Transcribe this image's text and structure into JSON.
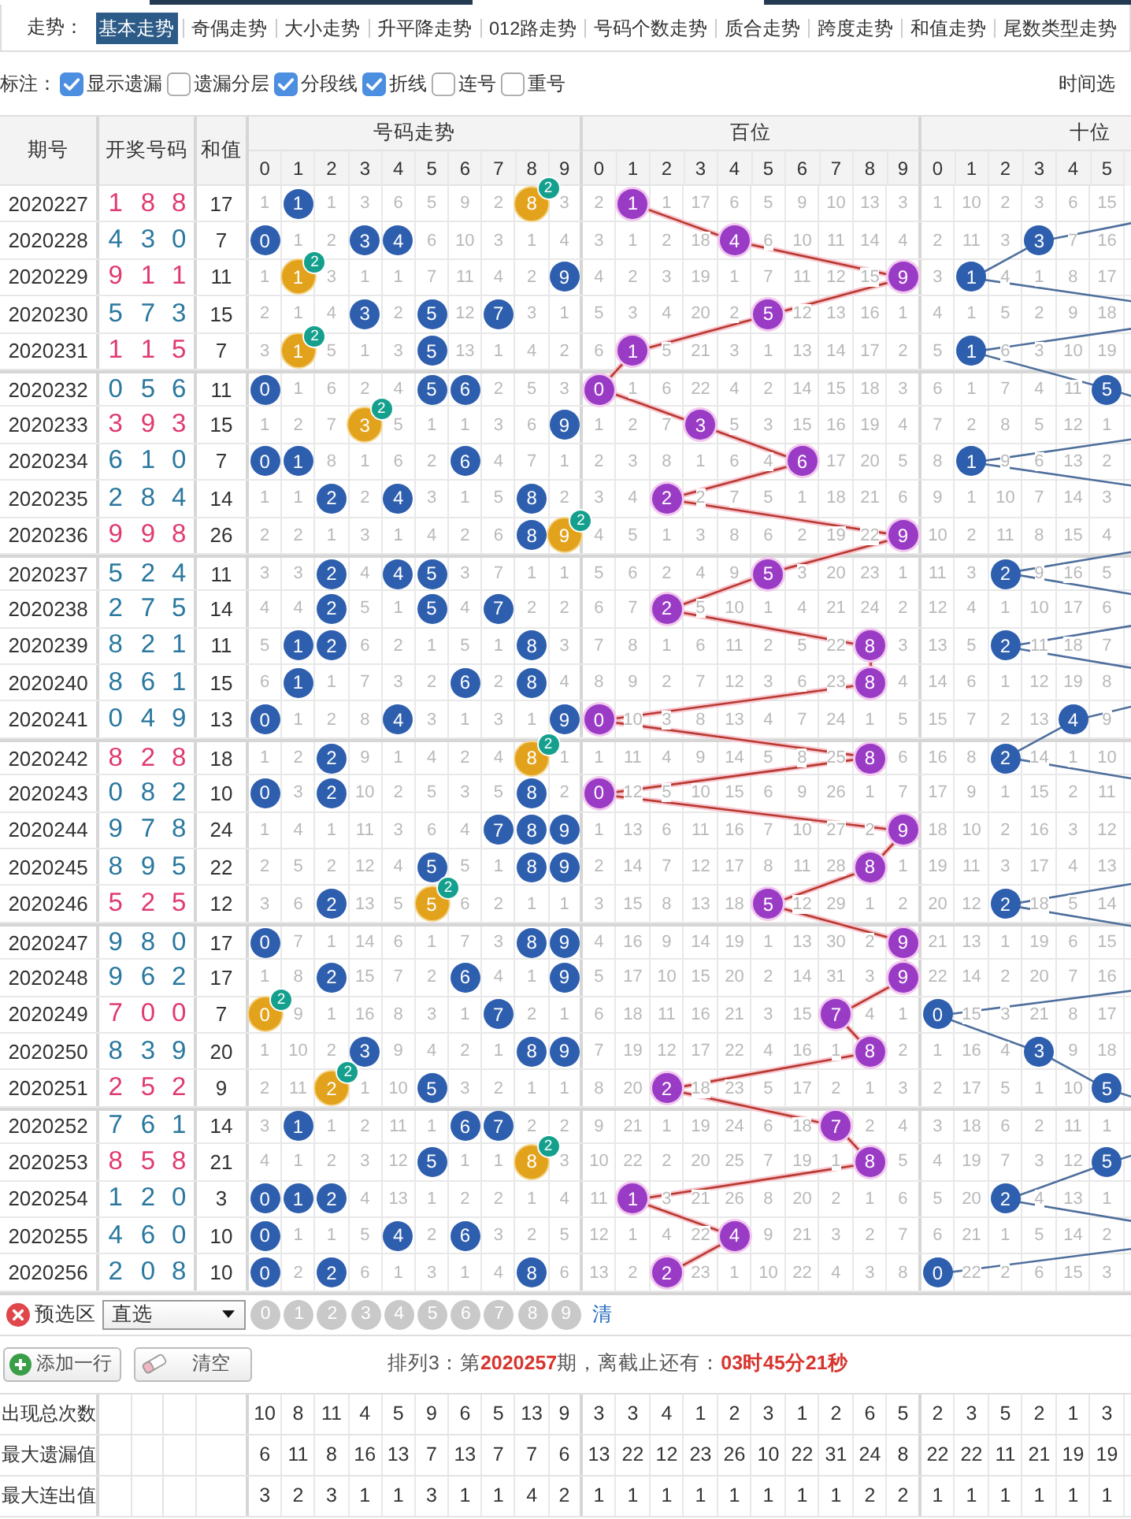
{
  "nav": {
    "label": "走势：",
    "tabs": [
      {
        "label": "基本走势",
        "selected": true
      },
      {
        "label": "奇偶走势",
        "selected": false
      },
      {
        "label": "大小走势",
        "selected": false
      },
      {
        "label": "升平降走势",
        "selected": false
      },
      {
        "label": "012路走势",
        "selected": false
      },
      {
        "label": "号码个数走势",
        "selected": false
      },
      {
        "label": "质合走势",
        "selected": false
      },
      {
        "label": "跨度走势",
        "selected": false
      },
      {
        "label": "和值走势",
        "selected": false
      },
      {
        "label": "尾数类型走势",
        "selected": false
      }
    ]
  },
  "marks": {
    "label": "标注：",
    "options": [
      {
        "label": "显示遗漏",
        "checked": true
      },
      {
        "label": "遗漏分层",
        "checked": false
      },
      {
        "label": "分段线",
        "checked": true
      },
      {
        "label": "折线",
        "checked": true
      },
      {
        "label": "连号",
        "checked": false
      },
      {
        "label": "重号",
        "checked": false
      }
    ],
    "time_label": "时间选"
  },
  "table": {
    "headers": {
      "period": "期号",
      "draw": "开奖号码",
      "sum": "和值"
    },
    "sections": [
      {
        "title": "号码走势",
        "kind": "number",
        "columns": [
          "0",
          "1",
          "2",
          "3",
          "4",
          "5",
          "6",
          "7",
          "8",
          "9"
        ]
      },
      {
        "title": "百位",
        "kind": "hundreds",
        "columns": [
          "0",
          "1",
          "2",
          "3",
          "4",
          "5",
          "6",
          "7",
          "8",
          "9"
        ]
      },
      {
        "title": "十位",
        "kind": "tens",
        "columns": [
          "0",
          "1",
          "2",
          "3",
          "4",
          "5"
        ]
      }
    ],
    "groups": [
      [
        {
          "period": "2020227",
          "digits": [
            "1",
            "8",
            "8"
          ],
          "pair": true,
          "sum": "17",
          "cells": [
            [
              "1",
              {
                "kind": "hit",
                "ball": "1"
              },
              "1",
              "3",
              "6",
              "5",
              "9",
              "2",
              {
                "kind": "repeat",
                "ball": "8",
                "badge": "2"
              },
              "3"
            ],
            [
              "2",
              {
                "kind": "hit",
                "ball": "1"
              },
              "1",
              "17",
              "6",
              "5",
              "9",
              "10",
              "13",
              "3"
            ],
            [
              "1",
              "10",
              "2",
              "3",
              "6",
              "15"
            ]
          ]
        },
        {
          "period": "2020228",
          "digits": [
            "4",
            "3",
            "0"
          ],
          "pair": false,
          "sum": "7",
          "cells": [
            [
              {
                "kind": "hit",
                "ball": "0"
              },
              "1",
              "2",
              {
                "kind": "hit",
                "ball": "3"
              },
              {
                "kind": "hit",
                "ball": "4"
              },
              "6",
              "10",
              "3",
              "1",
              "4"
            ],
            [
              "3",
              "1",
              "2",
              "18",
              {
                "kind": "hit",
                "ball": "4"
              },
              "6",
              "10",
              "11",
              "14",
              "4"
            ],
            [
              "2",
              "11",
              "3",
              {
                "kind": "hit",
                "ball": "3"
              },
              "7",
              "16"
            ]
          ]
        },
        {
          "period": "2020229",
          "digits": [
            "9",
            "1",
            "1"
          ],
          "pair": true,
          "sum": "11",
          "cells": [
            [
              "1",
              {
                "kind": "repeat",
                "ball": "1",
                "badge": "2"
              },
              "3",
              "1",
              "1",
              "7",
              "11",
              "4",
              "2",
              {
                "kind": "hit",
                "ball": "9"
              }
            ],
            [
              "4",
              "2",
              "3",
              "19",
              "1",
              "7",
              "11",
              "12",
              "15",
              {
                "kind": "hit",
                "ball": "9"
              }
            ],
            [
              "3",
              {
                "kind": "hit",
                "ball": "1"
              },
              "4",
              "1",
              "8",
              "17"
            ]
          ]
        },
        {
          "period": "2020230",
          "digits": [
            "5",
            "7",
            "3"
          ],
          "pair": false,
          "sum": "15",
          "cells": [
            [
              "2",
              "1",
              "4",
              {
                "kind": "hit",
                "ball": "3"
              },
              "2",
              {
                "kind": "hit",
                "ball": "5"
              },
              "12",
              {
                "kind": "hit",
                "ball": "7"
              },
              "3",
              "1"
            ],
            [
              "5",
              "3",
              "4",
              "20",
              "2",
              {
                "kind": "hit",
                "ball": "5"
              },
              "12",
              "13",
              "16",
              "1"
            ],
            [
              "4",
              "1",
              "5",
              "2",
              "9",
              "18"
            ]
          ]
        },
        {
          "period": "2020231",
          "digits": [
            "1",
            "1",
            "5"
          ],
          "pair": true,
          "sum": "7",
          "cells": [
            [
              "3",
              {
                "kind": "repeat",
                "ball": "1",
                "badge": "2"
              },
              "5",
              "1",
              "3",
              {
                "kind": "hit",
                "ball": "5"
              },
              "13",
              "1",
              "4",
              "2"
            ],
            [
              "6",
              {
                "kind": "hit",
                "ball": "1"
              },
              "5",
              "21",
              "3",
              "1",
              "13",
              "14",
              "17",
              "2"
            ],
            [
              "5",
              {
                "kind": "hit",
                "ball": "1"
              },
              "6",
              "3",
              "10",
              "19"
            ]
          ]
        }
      ],
      [
        {
          "period": "2020232",
          "digits": [
            "0",
            "5",
            "6"
          ],
          "pair": false,
          "sum": "11",
          "cells": [
            [
              {
                "kind": "hit",
                "ball": "0"
              },
              "1",
              "6",
              "2",
              "4",
              {
                "kind": "hit",
                "ball": "5"
              },
              {
                "kind": "hit",
                "ball": "6"
              },
              "2",
              "5",
              "3"
            ],
            [
              {
                "kind": "hit",
                "ball": "0"
              },
              "1",
              "6",
              "22",
              "4",
              "2",
              "14",
              "15",
              "18",
              "3"
            ],
            [
              "6",
              "1",
              "7",
              "4",
              "11",
              {
                "kind": "hit",
                "ball": "5"
              }
            ]
          ]
        },
        {
          "period": "2020233",
          "digits": [
            "3",
            "9",
            "3"
          ],
          "pair": true,
          "sum": "15",
          "cells": [
            [
              "1",
              "2",
              "7",
              {
                "kind": "repeat",
                "ball": "3",
                "badge": "2"
              },
              "5",
              "1",
              "1",
              "3",
              "6",
              {
                "kind": "hit",
                "ball": "9"
              }
            ],
            [
              "1",
              "2",
              "7",
              {
                "kind": "hit",
                "ball": "3"
              },
              "5",
              "3",
              "15",
              "16",
              "19",
              "4"
            ],
            [
              "7",
              "2",
              "8",
              "5",
              "12",
              "1"
            ]
          ]
        },
        {
          "period": "2020234",
          "digits": [
            "6",
            "1",
            "0"
          ],
          "pair": false,
          "sum": "7",
          "cells": [
            [
              {
                "kind": "hit",
                "ball": "0"
              },
              {
                "kind": "hit",
                "ball": "1"
              },
              "8",
              "1",
              "6",
              "2",
              {
                "kind": "hit",
                "ball": "6"
              },
              "4",
              "7",
              "1"
            ],
            [
              "2",
              "3",
              "8",
              "1",
              "6",
              "4",
              {
                "kind": "hit",
                "ball": "6"
              },
              "17",
              "20",
              "5"
            ],
            [
              "8",
              {
                "kind": "hit",
                "ball": "1"
              },
              "9",
              "6",
              "13",
              "2"
            ]
          ]
        },
        {
          "period": "2020235",
          "digits": [
            "2",
            "8",
            "4"
          ],
          "pair": false,
          "sum": "14",
          "cells": [
            [
              "1",
              "1",
              {
                "kind": "hit",
                "ball": "2"
              },
              "2",
              {
                "kind": "hit",
                "ball": "4"
              },
              "3",
              "1",
              "5",
              {
                "kind": "hit",
                "ball": "8"
              },
              "2"
            ],
            [
              "3",
              "4",
              {
                "kind": "hit",
                "ball": "2"
              },
              "2",
              "7",
              "5",
              "1",
              "18",
              "21",
              "6"
            ],
            [
              "9",
              "1",
              "10",
              "7",
              "14",
              "3"
            ]
          ]
        },
        {
          "period": "2020236",
          "digits": [
            "9",
            "9",
            "8"
          ],
          "pair": true,
          "sum": "26",
          "cells": [
            [
              "2",
              "2",
              "1",
              "3",
              "1",
              "4",
              "2",
              "6",
              {
                "kind": "hit",
                "ball": "8"
              },
              {
                "kind": "repeat",
                "ball": "9",
                "badge": "2"
              }
            ],
            [
              "4",
              "5",
              "1",
              "3",
              "8",
              "6",
              "2",
              "19",
              "22",
              {
                "kind": "hit",
                "ball": "9"
              }
            ],
            [
              "10",
              "2",
              "11",
              "8",
              "15",
              "4"
            ]
          ]
        }
      ],
      [
        {
          "period": "2020237",
          "digits": [
            "5",
            "2",
            "4"
          ],
          "pair": false,
          "sum": "11",
          "cells": [
            [
              "3",
              "3",
              {
                "kind": "hit",
                "ball": "2"
              },
              "4",
              {
                "kind": "hit",
                "ball": "4"
              },
              {
                "kind": "hit",
                "ball": "5"
              },
              "3",
              "7",
              "1",
              "1"
            ],
            [
              "5",
              "6",
              "2",
              "4",
              "9",
              {
                "kind": "hit",
                "ball": "5"
              },
              "3",
              "20",
              "23",
              "1"
            ],
            [
              "11",
              "3",
              {
                "kind": "hit",
                "ball": "2"
              },
              "9",
              "16",
              "5"
            ]
          ]
        },
        {
          "period": "2020238",
          "digits": [
            "2",
            "7",
            "5"
          ],
          "pair": false,
          "sum": "14",
          "cells": [
            [
              "4",
              "4",
              {
                "kind": "hit",
                "ball": "2"
              },
              "5",
              "1",
              {
                "kind": "hit",
                "ball": "5"
              },
              "4",
              {
                "kind": "hit",
                "ball": "7"
              },
              "2",
              "2"
            ],
            [
              "6",
              "7",
              {
                "kind": "hit",
                "ball": "2"
              },
              "5",
              "10",
              "1",
              "4",
              "21",
              "24",
              "2"
            ],
            [
              "12",
              "4",
              "1",
              "10",
              "17",
              "6"
            ]
          ]
        },
        {
          "period": "2020239",
          "digits": [
            "8",
            "2",
            "1"
          ],
          "pair": false,
          "sum": "11",
          "cells": [
            [
              "5",
              {
                "kind": "hit",
                "ball": "1"
              },
              {
                "kind": "hit",
                "ball": "2"
              },
              "6",
              "2",
              "1",
              "5",
              "1",
              {
                "kind": "hit",
                "ball": "8"
              },
              "3"
            ],
            [
              "7",
              "8",
              "1",
              "6",
              "11",
              "2",
              "5",
              "22",
              {
                "kind": "hit",
                "ball": "8"
              },
              "3"
            ],
            [
              "13",
              "5",
              {
                "kind": "hit",
                "ball": "2"
              },
              "11",
              "18",
              "7"
            ]
          ]
        },
        {
          "period": "2020240",
          "digits": [
            "8",
            "6",
            "1"
          ],
          "pair": false,
          "sum": "15",
          "cells": [
            [
              "6",
              {
                "kind": "hit",
                "ball": "1"
              },
              "1",
              "7",
              "3",
              "2",
              {
                "kind": "hit",
                "ball": "6"
              },
              "2",
              {
                "kind": "hit",
                "ball": "8"
              },
              "4"
            ],
            [
              "8",
              "9",
              "2",
              "7",
              "12",
              "3",
              "6",
              "23",
              {
                "kind": "hit",
                "ball": "8"
              },
              "4"
            ],
            [
              "14",
              "6",
              "1",
              "12",
              "19",
              "8"
            ]
          ]
        },
        {
          "period": "2020241",
          "digits": [
            "0",
            "4",
            "9"
          ],
          "pair": false,
          "sum": "13",
          "cells": [
            [
              {
                "kind": "hit",
                "ball": "0"
              },
              "1",
              "2",
              "8",
              {
                "kind": "hit",
                "ball": "4"
              },
              "3",
              "1",
              "3",
              "1",
              {
                "kind": "hit",
                "ball": "9"
              }
            ],
            [
              {
                "kind": "hit",
                "ball": "0"
              },
              "10",
              "3",
              "8",
              "13",
              "4",
              "7",
              "24",
              "1",
              "5"
            ],
            [
              "15",
              "7",
              "2",
              "13",
              {
                "kind": "hit",
                "ball": "4"
              },
              "9"
            ]
          ]
        }
      ],
      [
        {
          "period": "2020242",
          "digits": [
            "8",
            "2",
            "8"
          ],
          "pair": true,
          "sum": "18",
          "cells": [
            [
              "1",
              "2",
              {
                "kind": "hit",
                "ball": "2"
              },
              "9",
              "1",
              "4",
              "2",
              "4",
              {
                "kind": "repeat",
                "ball": "8",
                "badge": "2"
              },
              "1"
            ],
            [
              "1",
              "11",
              "4",
              "9",
              "14",
              "5",
              "8",
              "25",
              {
                "kind": "hit",
                "ball": "8"
              },
              "6"
            ],
            [
              "16",
              "8",
              {
                "kind": "hit",
                "ball": "2"
              },
              "14",
              "1",
              "10"
            ]
          ]
        },
        {
          "period": "2020243",
          "digits": [
            "0",
            "8",
            "2"
          ],
          "pair": false,
          "sum": "10",
          "cells": [
            [
              {
                "kind": "hit",
                "ball": "0"
              },
              "3",
              {
                "kind": "hit",
                "ball": "2"
              },
              "10",
              "2",
              "5",
              "3",
              "5",
              {
                "kind": "hit",
                "ball": "8"
              },
              "2"
            ],
            [
              {
                "kind": "hit",
                "ball": "0"
              },
              "12",
              "5",
              "10",
              "15",
              "6",
              "9",
              "26",
              "1",
              "7"
            ],
            [
              "17",
              "9",
              "1",
              "15",
              "2",
              "11"
            ]
          ]
        },
        {
          "period": "2020244",
          "digits": [
            "9",
            "7",
            "8"
          ],
          "pair": false,
          "sum": "24",
          "cells": [
            [
              "1",
              "4",
              "1",
              "11",
              "3",
              "6",
              "4",
              {
                "kind": "hit",
                "ball": "7"
              },
              {
                "kind": "hit",
                "ball": "8"
              },
              {
                "kind": "hit",
                "ball": "9"
              }
            ],
            [
              "1",
              "13",
              "6",
              "11",
              "16",
              "7",
              "10",
              "27",
              "2",
              {
                "kind": "hit",
                "ball": "9"
              }
            ],
            [
              "18",
              "10",
              "2",
              "16",
              "3",
              "12"
            ]
          ]
        },
        {
          "period": "2020245",
          "digits": [
            "8",
            "9",
            "5"
          ],
          "pair": false,
          "sum": "22",
          "cells": [
            [
              "2",
              "5",
              "2",
              "12",
              "4",
              {
                "kind": "hit",
                "ball": "5"
              },
              "5",
              "1",
              {
                "kind": "hit",
                "ball": "8"
              },
              {
                "kind": "hit",
                "ball": "9"
              }
            ],
            [
              "2",
              "14",
              "7",
              "12",
              "17",
              "8",
              "11",
              "28",
              {
                "kind": "hit",
                "ball": "8"
              },
              "1"
            ],
            [
              "19",
              "11",
              "3",
              "17",
              "4",
              "13"
            ]
          ]
        },
        {
          "period": "2020246",
          "digits": [
            "5",
            "2",
            "5"
          ],
          "pair": true,
          "sum": "12",
          "cells": [
            [
              "3",
              "6",
              {
                "kind": "hit",
                "ball": "2"
              },
              "13",
              "5",
              {
                "kind": "repeat",
                "ball": "5",
                "badge": "2"
              },
              "6",
              "2",
              "1",
              "1"
            ],
            [
              "3",
              "15",
              "8",
              "13",
              "18",
              {
                "kind": "hit",
                "ball": "5"
              },
              "12",
              "29",
              "1",
              "2"
            ],
            [
              "20",
              "12",
              {
                "kind": "hit",
                "ball": "2"
              },
              "18",
              "5",
              "14"
            ]
          ]
        }
      ],
      [
        {
          "period": "2020247",
          "digits": [
            "9",
            "8",
            "0"
          ],
          "pair": false,
          "sum": "17",
          "cells": [
            [
              {
                "kind": "hit",
                "ball": "0"
              },
              "7",
              "1",
              "14",
              "6",
              "1",
              "7",
              "3",
              {
                "kind": "hit",
                "ball": "8"
              },
              {
                "kind": "hit",
                "ball": "9"
              }
            ],
            [
              "4",
              "16",
              "9",
              "14",
              "19",
              "1",
              "13",
              "30",
              "2",
              {
                "kind": "hit",
                "ball": "9"
              }
            ],
            [
              "21",
              "13",
              "1",
              "19",
              "6",
              "15"
            ]
          ]
        },
        {
          "period": "2020248",
          "digits": [
            "9",
            "6",
            "2"
          ],
          "pair": false,
          "sum": "17",
          "cells": [
            [
              "1",
              "8",
              {
                "kind": "hit",
                "ball": "2"
              },
              "15",
              "7",
              "2",
              {
                "kind": "hit",
                "ball": "6"
              },
              "4",
              "1",
              {
                "kind": "hit",
                "ball": "9"
              }
            ],
            [
              "5",
              "17",
              "10",
              "15",
              "20",
              "2",
              "14",
              "31",
              "3",
              {
                "kind": "hit",
                "ball": "9"
              }
            ],
            [
              "22",
              "14",
              "2",
              "20",
              "7",
              "16"
            ]
          ]
        },
        {
          "period": "2020249",
          "digits": [
            "7",
            "0",
            "0"
          ],
          "pair": true,
          "sum": "7",
          "cells": [
            [
              {
                "kind": "repeat",
                "ball": "0",
                "badge": "2"
              },
              "9",
              "1",
              "16",
              "8",
              "3",
              "1",
              {
                "kind": "hit",
                "ball": "7"
              },
              "2",
              "1"
            ],
            [
              "6",
              "18",
              "11",
              "16",
              "21",
              "3",
              "15",
              {
                "kind": "hit",
                "ball": "7"
              },
              "4",
              "1"
            ],
            [
              {
                "kind": "hit",
                "ball": "0"
              },
              "15",
              "3",
              "21",
              "8",
              "17"
            ]
          ]
        },
        {
          "period": "2020250",
          "digits": [
            "8",
            "3",
            "9"
          ],
          "pair": false,
          "sum": "20",
          "cells": [
            [
              "1",
              "10",
              "2",
              {
                "kind": "hit",
                "ball": "3"
              },
              "9",
              "4",
              "2",
              "1",
              {
                "kind": "hit",
                "ball": "8"
              },
              {
                "kind": "hit",
                "ball": "9"
              }
            ],
            [
              "7",
              "19",
              "12",
              "17",
              "22",
              "4",
              "16",
              "1",
              {
                "kind": "hit",
                "ball": "8"
              },
              "2"
            ],
            [
              "1",
              "16",
              "4",
              {
                "kind": "hit",
                "ball": "3"
              },
              "9",
              "18"
            ]
          ]
        },
        {
          "period": "2020251",
          "digits": [
            "2",
            "5",
            "2"
          ],
          "pair": true,
          "sum": "9",
          "cells": [
            [
              "2",
              "11",
              {
                "kind": "repeat",
                "ball": "2",
                "badge": "2"
              },
              "1",
              "10",
              {
                "kind": "hit",
                "ball": "5"
              },
              "3",
              "2",
              "1",
              "1"
            ],
            [
              "8",
              "20",
              {
                "kind": "hit",
                "ball": "2"
              },
              "18",
              "23",
              "5",
              "17",
              "2",
              "1",
              "3"
            ],
            [
              "2",
              "17",
              "5",
              "1",
              "10",
              {
                "kind": "hit",
                "ball": "5"
              }
            ]
          ]
        }
      ],
      [
        {
          "period": "2020252",
          "digits": [
            "7",
            "6",
            "1"
          ],
          "pair": false,
          "sum": "14",
          "cells": [
            [
              "3",
              {
                "kind": "hit",
                "ball": "1"
              },
              "1",
              "2",
              "11",
              "1",
              {
                "kind": "hit",
                "ball": "6"
              },
              {
                "kind": "hit",
                "ball": "7"
              },
              "2",
              "2"
            ],
            [
              "9",
              "21",
              "1",
              "19",
              "24",
              "6",
              "18",
              {
                "kind": "hit",
                "ball": "7"
              },
              "2",
              "4"
            ],
            [
              "3",
              "18",
              "6",
              "2",
              "11",
              "1"
            ]
          ]
        },
        {
          "period": "2020253",
          "digits": [
            "8",
            "5",
            "8"
          ],
          "pair": true,
          "sum": "21",
          "cells": [
            [
              "4",
              "1",
              "2",
              "3",
              "12",
              {
                "kind": "hit",
                "ball": "5"
              },
              "1",
              "1",
              {
                "kind": "repeat",
                "ball": "8",
                "badge": "2"
              },
              "3"
            ],
            [
              "10",
              "22",
              "2",
              "20",
              "25",
              "7",
              "19",
              "1",
              {
                "kind": "hit",
                "ball": "8"
              },
              "5"
            ],
            [
              "4",
              "19",
              "7",
              "3",
              "12",
              {
                "kind": "hit",
                "ball": "5"
              }
            ]
          ]
        },
        {
          "period": "2020254",
          "digits": [
            "1",
            "2",
            "0"
          ],
          "pair": false,
          "sum": "3",
          "cells": [
            [
              {
                "kind": "hit",
                "ball": "0"
              },
              {
                "kind": "hit",
                "ball": "1"
              },
              {
                "kind": "hit",
                "ball": "2"
              },
              "4",
              "13",
              "1",
              "2",
              "2",
              "1",
              "4"
            ],
            [
              "11",
              {
                "kind": "hit",
                "ball": "1"
              },
              "3",
              "21",
              "26",
              "8",
              "20",
              "2",
              "1",
              "6"
            ],
            [
              "5",
              "20",
              {
                "kind": "hit",
                "ball": "2"
              },
              "4",
              "13",
              "1"
            ]
          ]
        },
        {
          "period": "2020255",
          "digits": [
            "4",
            "6",
            "0"
          ],
          "pair": false,
          "sum": "10",
          "cells": [
            [
              {
                "kind": "hit",
                "ball": "0"
              },
              "1",
              "1",
              "5",
              {
                "kind": "hit",
                "ball": "4"
              },
              "2",
              {
                "kind": "hit",
                "ball": "6"
              },
              "3",
              "2",
              "5"
            ],
            [
              "12",
              "1",
              "4",
              "22",
              {
                "kind": "hit",
                "ball": "4"
              },
              "9",
              "21",
              "3",
              "2",
              "7"
            ],
            [
              "6",
              "21",
              "1",
              "5",
              "14",
              "2"
            ]
          ]
        },
        {
          "period": "2020256",
          "digits": [
            "2",
            "0",
            "8"
          ],
          "pair": false,
          "sum": "10",
          "cells": [
            [
              {
                "kind": "hit",
                "ball": "0"
              },
              "2",
              {
                "kind": "hit",
                "ball": "2"
              },
              "6",
              "1",
              "3",
              "1",
              "4",
              {
                "kind": "hit",
                "ball": "8"
              },
              "6"
            ],
            [
              "13",
              "2",
              {
                "kind": "hit",
                "ball": "2"
              },
              "23",
              "1",
              "10",
              "22",
              "4",
              "3",
              "8"
            ],
            [
              {
                "kind": "hit",
                "ball": "0"
              },
              "22",
              "2",
              "6",
              "15",
              "3"
            ]
          ]
        }
      ]
    ]
  },
  "preselect": {
    "label": "预选区",
    "mode": "直选",
    "balls": [
      "0",
      "1",
      "2",
      "3",
      "4",
      "5",
      "6",
      "7",
      "8",
      "9"
    ],
    "clear": "清"
  },
  "actions": {
    "add": "添加一行",
    "clear": "清空",
    "info": "排列3：第**2020257**期，离截止还有：**03时45分21秒**"
  },
  "stats": [
    {
      "label": "出现总次数",
      "values": [
        [
          "10",
          "8",
          "11",
          "4",
          "5",
          "9",
          "6",
          "5",
          "13",
          "9"
        ],
        [
          "3",
          "3",
          "4",
          "1",
          "2",
          "3",
          "1",
          "2",
          "6",
          "5"
        ],
        [
          "2",
          "3",
          "5",
          "2",
          "1",
          "3"
        ]
      ]
    },
    {
      "label": "最大遗漏值",
      "values": [
        [
          "6",
          "11",
          "8",
          "16",
          "13",
          "7",
          "13",
          "7",
          "7",
          "6"
        ],
        [
          "13",
          "22",
          "12",
          "23",
          "26",
          "10",
          "22",
          "31",
          "24",
          "8"
        ],
        [
          "22",
          "22",
          "11",
          "21",
          "19",
          "19"
        ]
      ]
    },
    {
      "label": "最大连出值",
      "values": [
        [
          "3",
          "2",
          "3",
          "1",
          "1",
          "3",
          "1",
          "1",
          "4",
          "2"
        ],
        [
          "1",
          "1",
          "1",
          "1",
          "1",
          "1",
          "1",
          "1",
          "2",
          "2"
        ],
        [
          "1",
          "1",
          "1",
          "1",
          "1",
          "1"
        ]
      ]
    }
  ]
}
